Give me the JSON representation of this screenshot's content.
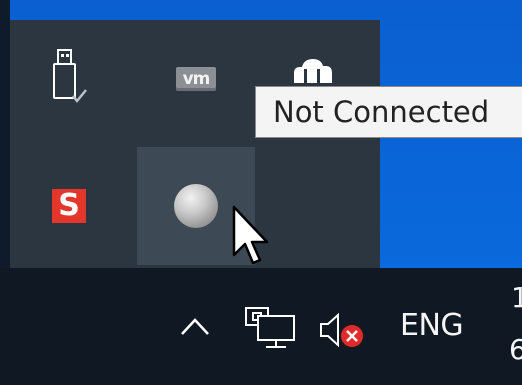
{
  "tray_flyout": {
    "icons": [
      {
        "name": "usb-drive-icon"
      },
      {
        "name": "vmware-icon",
        "text": "vm"
      },
      {
        "name": "cloud-icon"
      },
      {
        "name": "s-app-icon",
        "text": "S"
      },
      {
        "name": "globe-icon",
        "state": "hovered"
      }
    ]
  },
  "tooltip": {
    "text": "Not Connected"
  },
  "taskbar": {
    "show_hidden_icons": "chevron-up-icon",
    "network_status": "disconnected",
    "volume_status": "muted",
    "language": "ENG",
    "clock_time_partial": "1",
    "clock_date_partial": "6"
  },
  "colors": {
    "desktop": "#0a64d6",
    "flyout": "#2b3641",
    "flyout_hover": "#3d4954",
    "taskbar": "#101923",
    "mute_badge": "#e02a2a",
    "s_icon": "#e2372a"
  }
}
